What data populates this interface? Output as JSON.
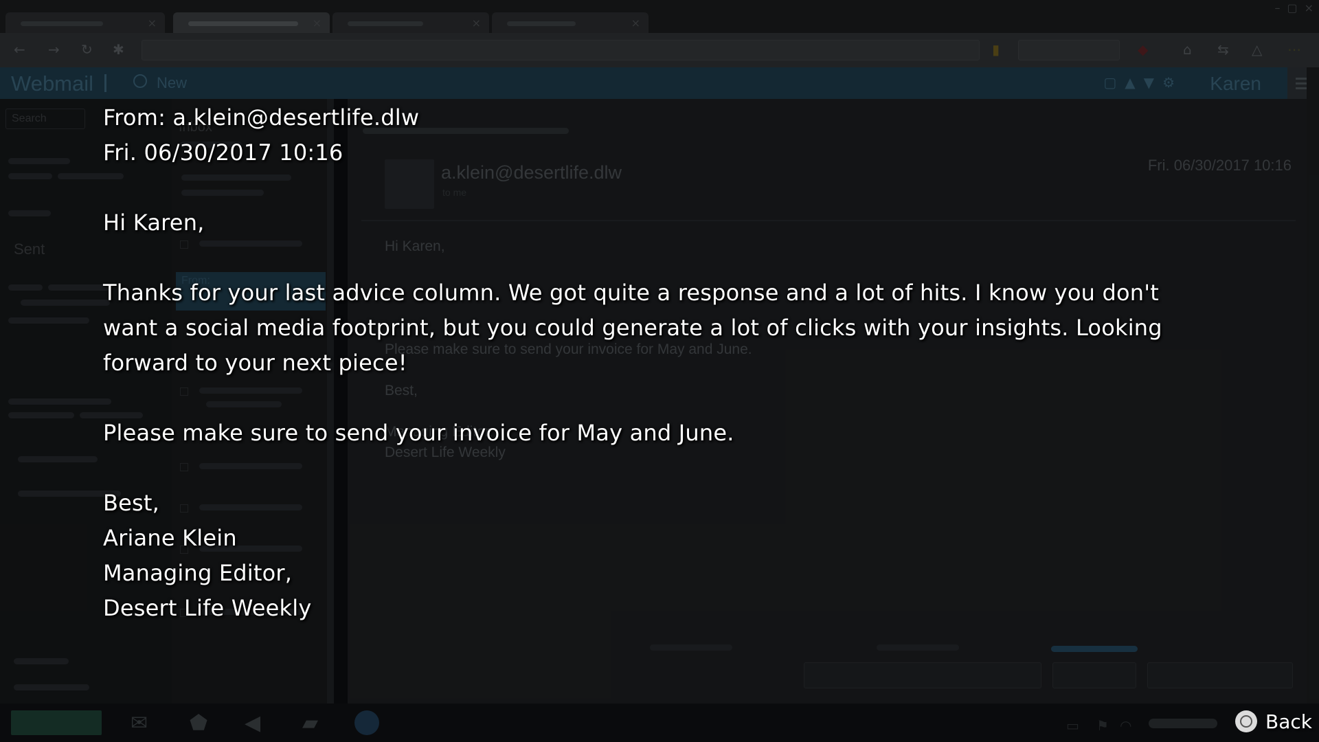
{
  "browser": {
    "tab_count": 4
  },
  "webmail": {
    "title": "Webmail",
    "new_label": "New",
    "user": "Karen",
    "search_placeholder": "Search",
    "nav_sent": "Sent",
    "inbox_title": "Inbox",
    "selected_item": "From:"
  },
  "reading_pane": {
    "sender": "a.klein@desertlife.dlw",
    "to": "to me",
    "date": "Fri. 06/30/2017 10:16",
    "greeting": "Hi Karen,",
    "invoice_line": "Please make sure to send your invoice for May and June.",
    "signoff": "Best,",
    "title_line": "Managing Editor,",
    "publication": "Desert Life Weekly"
  },
  "transcript": {
    "from_line": "From: a.klein@desertlife.dlw",
    "date_line": "Fri. 06/30/2017 10:16",
    "greeting": "Hi Karen,",
    "paragraph": "Thanks for your last advice column. We got quite a response and a lot of hits. I know you don't want a social media footprint, but you could generate a lot of clicks with your insights. Looking forward to your next piece!",
    "invoice_line": "Please make sure to send your invoice for May and June.",
    "signoff": "Best,",
    "name": "Ariane Klein",
    "title_line": "Managing Editor,",
    "publication": "Desert Life Weekly"
  },
  "prompt": {
    "back_label": "Back",
    "back_button_icon": "circle-button-icon"
  },
  "colors": {
    "accent": "#1d3a4a",
    "text": "#ffffff",
    "background": "#0c0e10"
  }
}
